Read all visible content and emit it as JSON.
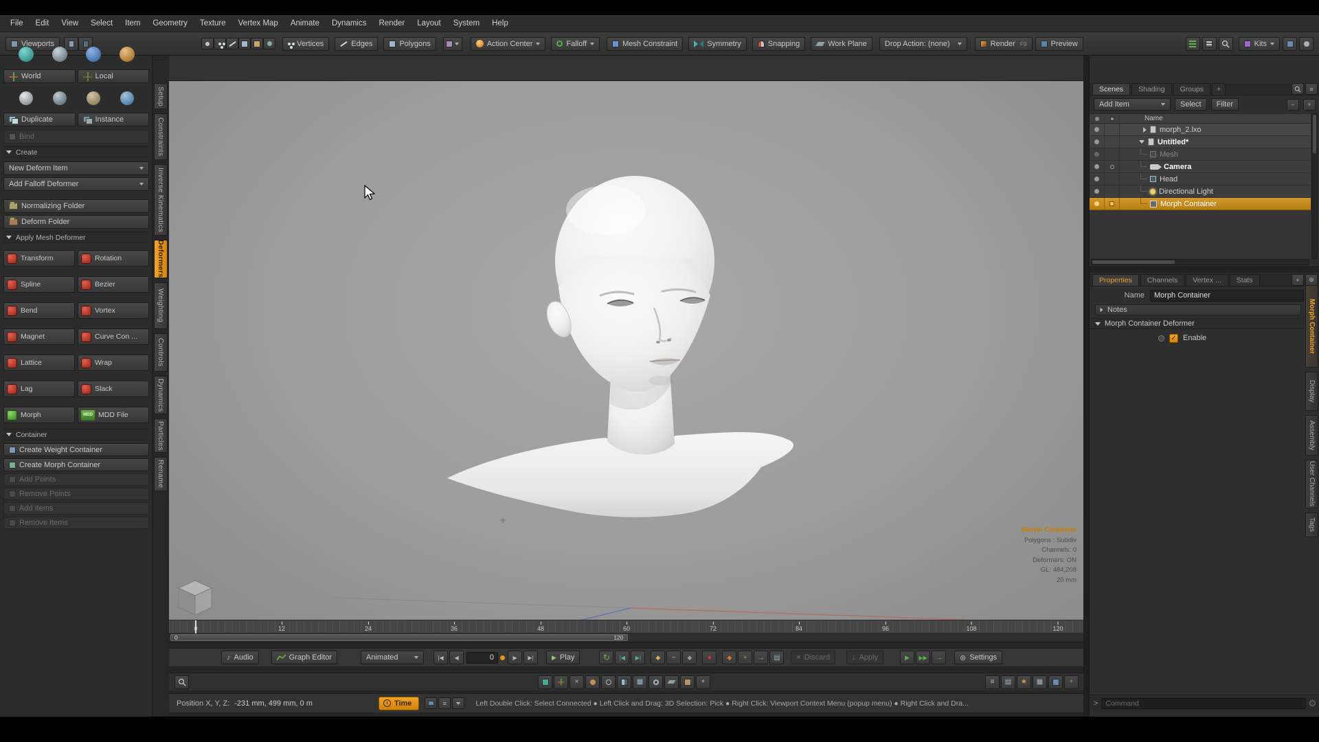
{
  "menu": {
    "items": [
      "File",
      "Edit",
      "View",
      "Select",
      "Item",
      "Geometry",
      "Texture",
      "Vertex Map",
      "Animate",
      "Dynamics",
      "Render",
      "Layout",
      "System",
      "Help"
    ]
  },
  "toolbar": {
    "viewports": "Viewports",
    "vertices": "Vertices",
    "edges": "Edges",
    "polygons": "Polygons",
    "action_center": "Action Center",
    "falloff": "Falloff",
    "mesh_constraint": "Mesh Constraint",
    "symmetry": "Symmetry",
    "snapping": "Snapping",
    "work_plane": "Work Plane",
    "drop_action": "Drop Action: (none)",
    "render": "Render",
    "render_key": "F9",
    "preview": "Preview",
    "kits": "Kits"
  },
  "left_tabs": {
    "items": [
      "Setup",
      "Constraints",
      "Inverse Kinematics",
      "Deformers",
      "Weighting",
      "Controls",
      "Dynamics",
      "Particles",
      "Rename"
    ],
    "active": "Deformers"
  },
  "left_panel": {
    "world": "World",
    "local": "Local",
    "duplicate": "Duplicate",
    "instance": "Instance",
    "bind": "Bind",
    "create_header": "Create",
    "new_deform_item": "New Deform Item",
    "add_falloff_deformer": "Add Falloff Deformer",
    "normalizing_folder": "Normalizing Folder",
    "deform_folder": "Deform Folder",
    "apply_header": "Apply Mesh Deformer",
    "grid": [
      {
        "left": "Transform",
        "right": "Rotation"
      },
      {
        "left": "Spline",
        "right": "Bezier"
      },
      {
        "left": "Bend",
        "right": "Vortex"
      },
      {
        "left": "Magnet",
        "right": "Curve Con ..."
      },
      {
        "left": "Lattice",
        "right": "Wrap"
      },
      {
        "left": "Lag",
        "right": "Slack"
      },
      {
        "left": "Morph",
        "right": "MDD File"
      }
    ],
    "mdd_badge": "MDD",
    "container_header": "Container",
    "create_weight_container": "Create Weight Container",
    "create_morph_container": "Create Morph Container",
    "add_points": "Add Points",
    "remove_points": "Remove Points",
    "add_items": "Add Items",
    "remove_items": "Remove Items"
  },
  "viewport": {
    "camera_mode": "Perspective",
    "shading_mode": "Default",
    "info": {
      "title": "Morph Container",
      "line1": "Polygons : Subdiv",
      "line2": "Channels: 0",
      "line3": "Deformers: ON",
      "line4": "GL: 484,208",
      "line5": "20 mm"
    }
  },
  "timeline": {
    "ticks": [
      "0",
      "12",
      "24",
      "36",
      "48",
      "60",
      "72",
      "84",
      "96",
      "108",
      "120"
    ],
    "range_start": "0",
    "range_end": "120"
  },
  "playback": {
    "audio": "Audio",
    "graph_editor": "Graph Editor",
    "mode": "Animated",
    "frame": "0",
    "play": "Play",
    "discard": "Discard",
    "apply": "Apply",
    "settings": "Settings"
  },
  "status": {
    "position_label": "Position X, Y, Z:",
    "position_value": "-231 mm, 499 mm, 0 m",
    "time": "Time",
    "help": "Left Double Click: Select Connected ● Left Click and Drag: 3D Selection: Pick ● Right Click: Viewport Context Menu (popup menu) ● Right Click and Dra..."
  },
  "scenes": {
    "tabs": [
      "Scenes",
      "Shading",
      "Groups"
    ],
    "add_tab": "+",
    "add_item": "Add Item",
    "select": "Select",
    "filter": "Filter",
    "name_col": "Name",
    "tree": [
      {
        "label": "morph_2.lxo"
      },
      {
        "label": "Untitled*"
      },
      {
        "label": "Mesh"
      },
      {
        "label": "Camera"
      },
      {
        "label": "Head"
      },
      {
        "label": "Directional Light"
      },
      {
        "label": "Morph Container"
      }
    ]
  },
  "properties": {
    "tabs": [
      "Properties",
      "Channels",
      "Vertex ...",
      "Stats"
    ],
    "name_label": "Name",
    "name_value": "Morph Container",
    "notes": "Notes",
    "section": "Morph Container Deformer",
    "enable": "Enable",
    "side_tabs": [
      "Morph Container",
      "Display",
      "Assembly",
      "User Channels",
      "Tags"
    ]
  },
  "command": {
    "prompt": ">",
    "label": "Command"
  },
  "glyphs": {
    "note": "♪",
    "rewind": "|◀",
    "step_back": "◀",
    "step_fwd": "▶",
    "to_end": "▶|",
    "play": "▶",
    "double_play": "▶▶",
    "record": "●",
    "loop": "↻",
    "check": "✓",
    "gear": "⊛",
    "plus": "+",
    "minus": "−",
    "key": "◆",
    "x": "×",
    "down": "↓",
    "menu": "≡",
    "grid": "▦",
    "rows": "▤",
    "star": "★",
    "arrow": "→"
  },
  "colors": {
    "accent_orange": "#e8940f",
    "record_red": "#cc2b22",
    "go_green": "#58b04a"
  }
}
